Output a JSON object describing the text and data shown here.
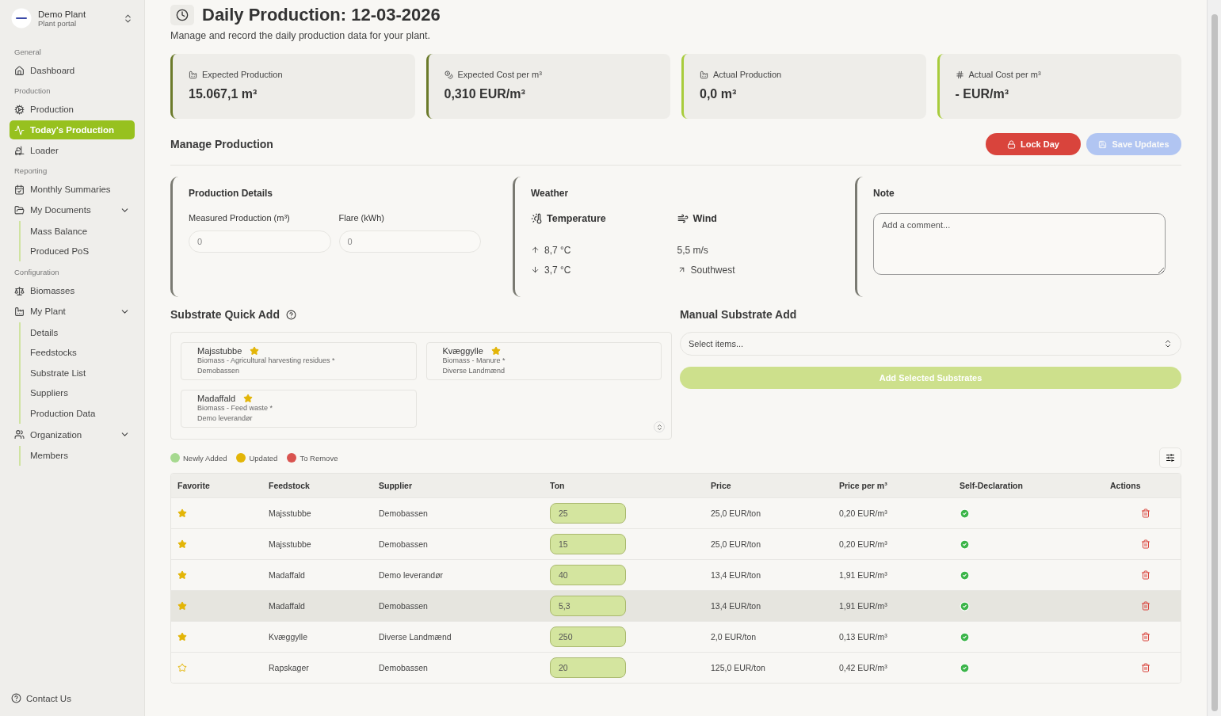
{
  "sidebar": {
    "brand": {
      "name": "Demo Plant",
      "subtitle": "Plant portal"
    },
    "sections": [
      {
        "title": "General",
        "items": [
          {
            "label": "Dashboard",
            "selected": false
          }
        ]
      },
      {
        "title": "Production",
        "items": [
          {
            "label": "Production",
            "selected": false
          },
          {
            "label": "Today's Production",
            "selected": true
          },
          {
            "label": "Loader",
            "selected": false
          }
        ]
      },
      {
        "title": "Reporting",
        "items": [
          {
            "label": "Monthly Summaries",
            "selected": false
          },
          {
            "label": "My Documents",
            "selected": false,
            "expanded": true,
            "children": [
              {
                "label": "Mass Balance",
                "selected": false
              },
              {
                "label": "Produced PoS",
                "selected": false
              }
            ]
          }
        ]
      },
      {
        "title": "Configuration",
        "items": [
          {
            "label": "Biomasses",
            "selected": false
          },
          {
            "label": "My Plant",
            "selected": false,
            "expanded": true,
            "children": [
              {
                "label": "Details",
                "selected": false
              },
              {
                "label": "Feedstocks",
                "selected": false
              },
              {
                "label": "Substrate List",
                "selected": false
              },
              {
                "label": "Suppliers",
                "selected": false
              },
              {
                "label": "Production Data",
                "selected": false
              }
            ]
          },
          {
            "label": "Organization",
            "selected": false,
            "expanded": true,
            "children": [
              {
                "label": "Members",
                "selected": false
              }
            ]
          }
        ]
      }
    ],
    "footer": "Contact Us"
  },
  "page": {
    "title": "Daily Production: 12-03-2026",
    "subtitle": "Manage and record the daily production data for your plant."
  },
  "stats": [
    {
      "label": "Expected Production",
      "value": "15.067,1 m³",
      "color": "#6b7a2a"
    },
    {
      "label": "Expected Cost per m³",
      "value": "0,310 EUR/m³",
      "color": "#6b7a2a"
    },
    {
      "label": "Actual Production",
      "value": "0,0 m³",
      "color": "#a8cc3c"
    },
    {
      "label": "Actual Cost per m³",
      "value": "- EUR/m³",
      "color": "#a8cc3c"
    }
  ],
  "manage": {
    "title": "Manage Production",
    "buttons": [
      {
        "label": "Lock Day",
        "kind": "danger",
        "disabled": false
      },
      {
        "label": "Save Updates",
        "kind": "primary",
        "disabled": true
      }
    ]
  },
  "production_details": {
    "title": "Production Details",
    "fields": [
      {
        "label": "Measured Production (m³)",
        "placeholder": "0"
      },
      {
        "label": "Flare (kWh)",
        "placeholder": "0"
      }
    ]
  },
  "weather": {
    "title": "Weather",
    "temperature": {
      "label": "Temperature",
      "high": "8,7 °C",
      "low": "3,7 °C"
    },
    "wind": {
      "label": "Wind",
      "speed": "5,5 m/s",
      "direction": "Southwest"
    }
  },
  "note": {
    "title": "Note",
    "placeholder": "Add a comment..."
  },
  "quick_add": {
    "title": "Substrate Quick Add",
    "items": [
      {
        "name": "Majsstubbe",
        "category": "Biomass - Agricultural harvesting residues *",
        "supplier": "Demobassen",
        "favorite": true
      },
      {
        "name": "Kvæggylle",
        "category": "Biomass - Manure *",
        "supplier": "Diverse Landmænd",
        "favorite": true
      },
      {
        "name": "Madaffald",
        "category": "Biomass - Feed waste *",
        "supplier": "Demo leverandør",
        "favorite": true
      }
    ]
  },
  "manual_add": {
    "title": "Manual Substrate Add",
    "placeholder": "Select items...",
    "button": {
      "label": "Add Selected Substrates",
      "disabled": true
    }
  },
  "legend": [
    {
      "label": "Newly Added",
      "color": "#a6d98f"
    },
    {
      "label": "Updated",
      "color": "#e3b507"
    },
    {
      "label": "To Remove",
      "color": "#d9534f"
    }
  ],
  "table": {
    "columns": [
      "Favorite",
      "Feedstock",
      "Supplier",
      "Ton",
      "Price",
      "Price per m³",
      "Self-Declaration",
      "Actions"
    ],
    "rows": [
      {
        "favorite": true,
        "feedstock": "Majsstubbe",
        "supplier": "Demobassen",
        "ton": "25",
        "price": "25,0 EUR/ton",
        "price_m3": "0,20 EUR/m³",
        "self_declared": true,
        "selected": false
      },
      {
        "favorite": true,
        "feedstock": "Majsstubbe",
        "supplier": "Demobassen",
        "ton": "15",
        "price": "25,0 EUR/ton",
        "price_m3": "0,20 EUR/m³",
        "self_declared": true,
        "selected": false
      },
      {
        "favorite": true,
        "feedstock": "Madaffald",
        "supplier": "Demo leverandør",
        "ton": "40",
        "price": "13,4 EUR/ton",
        "price_m3": "1,91 EUR/m³",
        "self_declared": true,
        "selected": false
      },
      {
        "favorite": true,
        "feedstock": "Madaffald",
        "supplier": "Demobassen",
        "ton": "5,3",
        "price": "13,4 EUR/ton",
        "price_m3": "1,91 EUR/m³",
        "self_declared": true,
        "selected": true
      },
      {
        "favorite": true,
        "feedstock": "Kvæggylle",
        "supplier": "Diverse Landmænd",
        "ton": "250",
        "price": "2,0 EUR/ton",
        "price_m3": "0,13 EUR/m³",
        "self_declared": true,
        "selected": false
      },
      {
        "favorite": false,
        "feedstock": "Rapskager",
        "supplier": "Demobassen",
        "ton": "20",
        "price": "125,0 EUR/ton",
        "price_m3": "0,42 EUR/m³",
        "self_declared": true,
        "selected": false
      }
    ]
  }
}
